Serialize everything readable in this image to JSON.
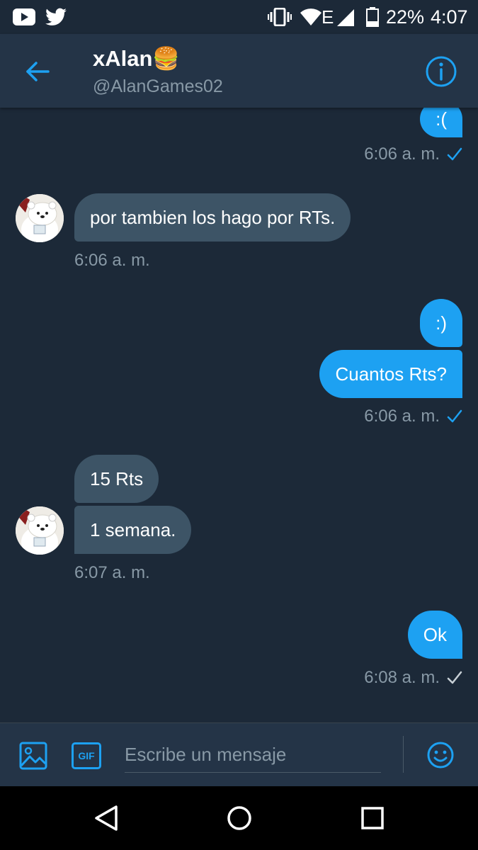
{
  "status_bar": {
    "battery": "22%",
    "time": "4:07",
    "network": "E",
    "icons": [
      "youtube-icon",
      "twitter-icon",
      "vibrate-icon",
      "wifi-icon",
      "signal-icon",
      "battery-icon"
    ]
  },
  "header": {
    "name": "xAlan🍔",
    "handle": "@AlanGames02"
  },
  "messages": [
    {
      "direction": "out",
      "text": ":(",
      "time": "6:06 a. m.",
      "status": "read"
    },
    {
      "direction": "in",
      "texts": [
        "por tambien los hago por RTs."
      ],
      "time": "6:06 a. m."
    },
    {
      "direction": "out",
      "texts": [
        ":)",
        "Cuantos Rts?"
      ],
      "time": "6:06 a. m.",
      "status": "read"
    },
    {
      "direction": "in",
      "texts": [
        "15 Rts",
        "1 semana."
      ],
      "time": "6:07 a. m."
    },
    {
      "direction": "out",
      "texts": [
        "Ok"
      ],
      "time": "6:08 a. m.",
      "status": "sent"
    }
  ],
  "composer": {
    "placeholder": "Escribe un mensaje",
    "gif_label": "GIF"
  },
  "colors": {
    "accent": "#1da1f2",
    "background": "#1c2938",
    "header": "#243447",
    "incoming_bubble": "#3d5466",
    "secondary_text": "#8899a6"
  }
}
